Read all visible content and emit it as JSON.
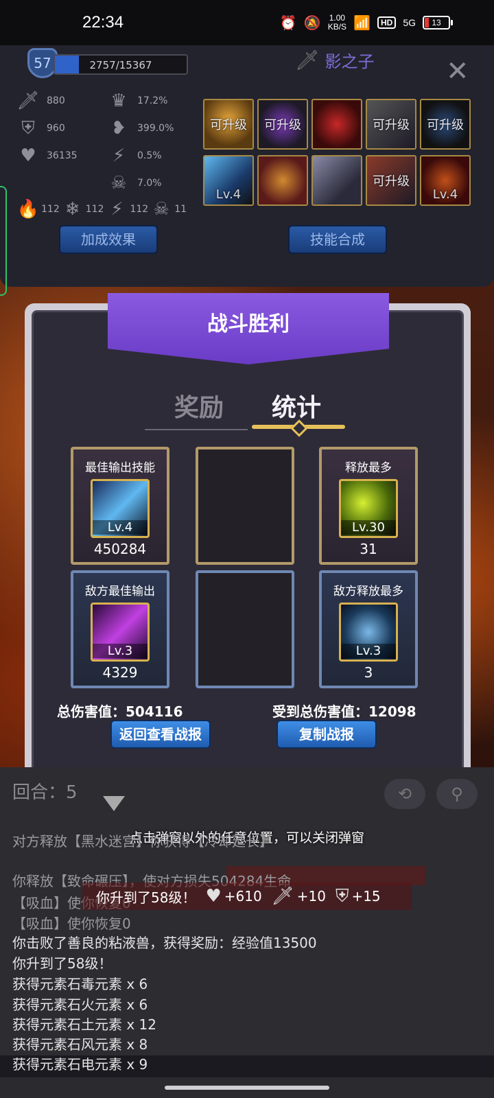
{
  "status_bar": {
    "time": "22:34",
    "net_speed_value": "1.00",
    "net_speed_unit": "KB/S",
    "hd": "HD",
    "signal": "5G",
    "battery": "13"
  },
  "top_panel": {
    "level": "57",
    "xp_text": "2757/15367",
    "xp_fraction": 0.18,
    "character_name": "影之子",
    "stats": {
      "attack": "880",
      "defense": "960",
      "health": "36135",
      "crit_rate": "17.2%",
      "crit_damage": "399.0%",
      "dodge": "0.5%",
      "fatal": "7.0%",
      "fire": "112",
      "ice": "112",
      "lightning": "112",
      "poison": "11"
    },
    "skills": [
      {
        "label": "可升级",
        "lv": ""
      },
      {
        "label": "可升级",
        "lv": ""
      },
      {
        "label": "",
        "lv": ""
      },
      {
        "label": "可升级",
        "lv": ""
      },
      {
        "label": "可升级",
        "lv": ""
      },
      {
        "label": "",
        "lv": "Lv.4"
      },
      {
        "label": "",
        "lv": ""
      },
      {
        "label": "",
        "lv": ""
      },
      {
        "label": "可升级",
        "lv": ""
      },
      {
        "label": "",
        "lv": "Lv.4"
      }
    ],
    "bonus_button": "加成效果",
    "synthesis_button": "技能合成"
  },
  "modal": {
    "title": "战斗胜利",
    "tab_rewards": "奖励",
    "tab_stats": "统计",
    "cards": {
      "best_output": {
        "title": "最佳输出技能",
        "lv": "Lv.4",
        "value": "450284"
      },
      "most_cast": {
        "title": "释放最多",
        "lv": "Lv.30",
        "value": "31"
      },
      "enemy_best_output": {
        "title": "敌方最佳输出",
        "lv": "Lv.3",
        "value": "4329"
      },
      "enemy_most_cast": {
        "title": "敌方释放最多",
        "lv": "Lv.3",
        "value": "3"
      }
    },
    "total_damage_label": "总伤害值：504116",
    "damage_taken_label": "受到总伤害值：12098",
    "back_report_button": "返回查看战报",
    "copy_report_button": "复制战报"
  },
  "log": {
    "round_label": "回合：5",
    "close_hint": "点击弹窗以外的任意位置，可以关闭弹窗",
    "lines": [
      "对方释放【黑水迷宫】你获得【冷却延长】",
      "你释放【致命碾压】，使对方损失504284生命",
      "【吸血】使你恢复0",
      "【吸血】使你恢复0",
      "你击败了善良的粘液兽，获得奖励：经验值13500",
      "你升到了58级！",
      "获得元素石毒元素 x 6",
      "获得元素石火元素 x 6",
      "获得元素石土元素 x 12",
      "获得元素石风元素 x 8",
      "获得元素石电元素 x 9"
    ],
    "levelup_banner": {
      "text": "你升到了58级！",
      "health_bonus": "+610",
      "attack_bonus": "+10",
      "defense_bonus": "+15"
    }
  }
}
